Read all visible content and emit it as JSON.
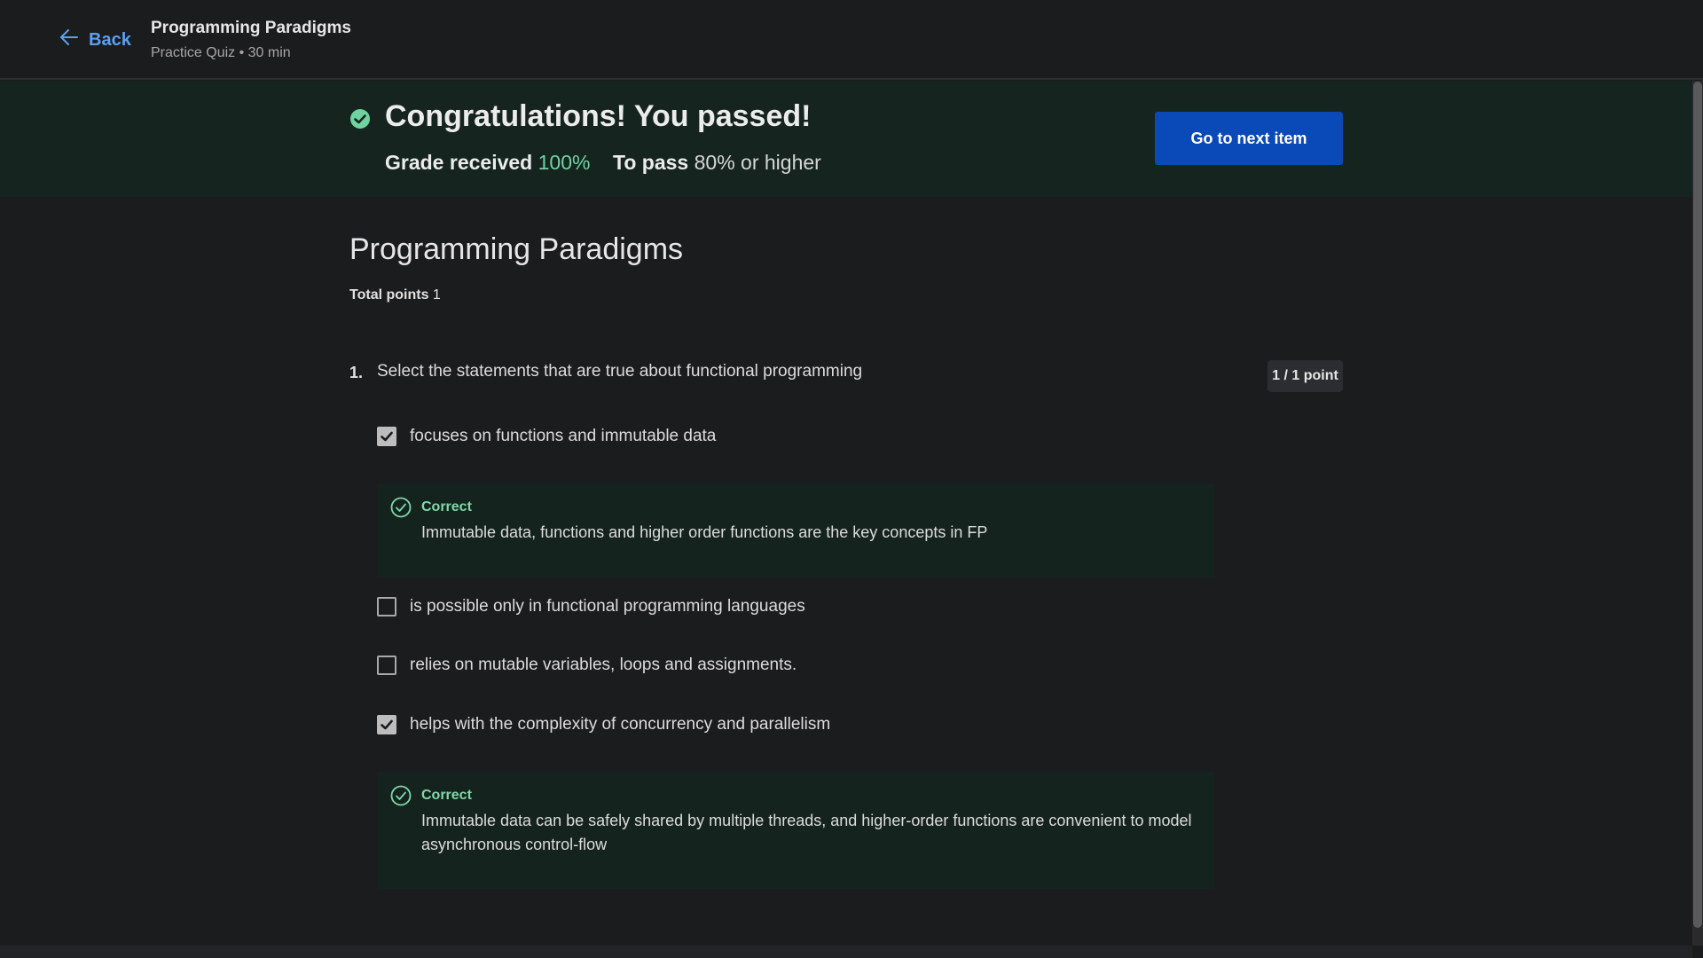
{
  "header": {
    "back_label": "Back",
    "course_title": "Programming Paradigms",
    "course_subtitle": "Practice Quiz • 30 min"
  },
  "banner": {
    "title": "Congratulations! You passed!",
    "grade_label": "Grade received",
    "grade_value": "100%",
    "pass_label": "To pass",
    "pass_value": "80% or higher",
    "next_button_label": "Go to next item",
    "accent_color": "#6fd3a0",
    "button_color": "#0a49b8"
  },
  "quiz": {
    "title": "Programming Paradigms",
    "total_points_label": "Total points",
    "total_points_value": "1",
    "question": {
      "number": "1.",
      "text": "Select the statements that are true about functional programming",
      "points": "1 / 1 point",
      "options": [
        {
          "label": "focuses on functions and immutable data",
          "checked": true,
          "feedback": {
            "title": "Correct",
            "text": "Immutable data, functions and higher order functions are the key concepts in FP"
          }
        },
        {
          "label": "is possible only in functional programming languages",
          "checked": false
        },
        {
          "label": "relies on mutable variables, loops and assignments.",
          "checked": false
        },
        {
          "label": "helps with the complexity of concurrency and parallelism",
          "checked": true,
          "feedback": {
            "title": "Correct",
            "text": "Immutable data can be safely shared by multiple threads, and higher-order functions are convenient to model asynchronous control-flow"
          }
        }
      ]
    }
  }
}
